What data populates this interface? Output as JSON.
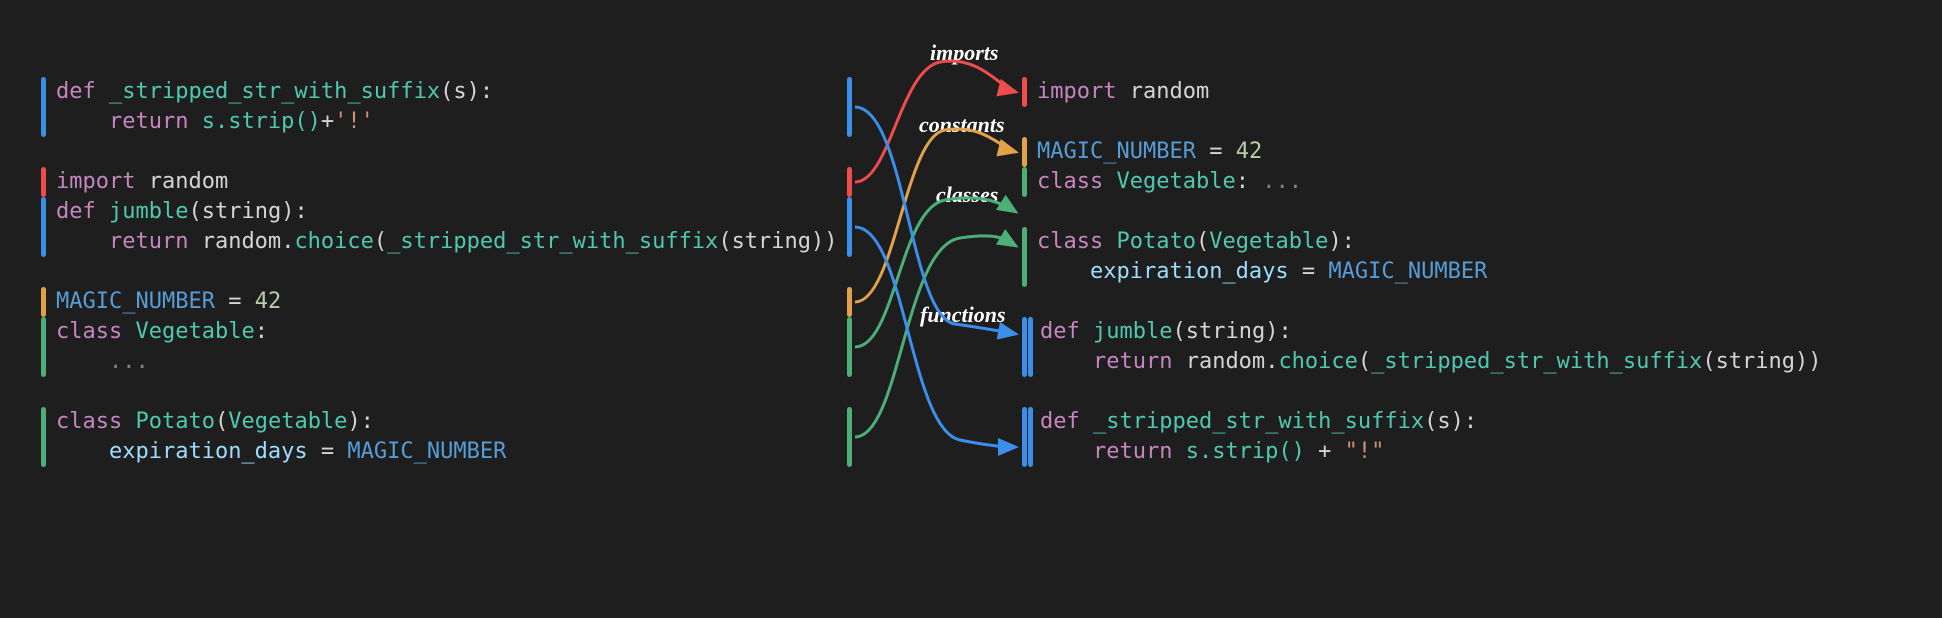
{
  "labels": {
    "imports": "imports",
    "constants": "constants",
    "classes": "classes",
    "functions": "functions"
  },
  "code": {
    "left": {
      "line1": {
        "kw": "def ",
        "fn": "_stripped_str_with_suffix",
        "pn_open": "(",
        "arg": "s",
        "pn_close": "):"
      },
      "line2": {
        "indent": "    ",
        "kw": "return ",
        "call": "s.strip()",
        "op": "+",
        "str": "'!'"
      },
      "line4": {
        "kw": "import ",
        "mod": "random"
      },
      "line5": {
        "kw": "def ",
        "fn": "jumble",
        "pn_open": "(",
        "arg": "string",
        "pn_close": "):"
      },
      "line6": {
        "indent": "    ",
        "kw": "return ",
        "ns": "random",
        "dot": ".",
        "method": "choice",
        "pn_open": "(",
        "inner": "_stripped_str_with_suffix",
        "pn_open2": "(",
        "arg": "string",
        "pn_close2": ")",
        "pn_close": ")"
      },
      "line8": {
        "name": "MAGIC_NUMBER",
        "eq": " = ",
        "val": "42"
      },
      "line9": {
        "kw": "class ",
        "cls": "Vegetable",
        "colon": ":"
      },
      "line10": {
        "indent": "    ",
        "ell": "..."
      },
      "line12": {
        "kw": "class ",
        "cls": "Potato",
        "pn_open": "(",
        "base": "Vegetable",
        "pn_close": "):"
      },
      "line13": {
        "indent": "    ",
        "prop": "expiration_days",
        "eq": " = ",
        "val": "MAGIC_NUMBER"
      }
    },
    "right": {
      "line1": {
        "kw": "import ",
        "mod": "random"
      },
      "line3": {
        "name": "MAGIC_NUMBER",
        "eq": " = ",
        "val": "42"
      },
      "line4": {
        "kw": "class ",
        "cls": "Vegetable",
        "colon": ": ",
        "ell": "..."
      },
      "line6": {
        "kw": "class ",
        "cls": "Potato",
        "pn_open": "(",
        "base": "Vegetable",
        "pn_close": "):"
      },
      "line7": {
        "indent": "    ",
        "prop": "expiration_days",
        "eq": " = ",
        "val": "MAGIC_NUMBER"
      },
      "line9": {
        "kw": "def ",
        "fn": "jumble",
        "pn_open": "(",
        "arg": "string",
        "pn_close": "):"
      },
      "line10": {
        "indent": "    ",
        "kw": "return ",
        "ns": "random",
        "dot": ".",
        "method": "choice",
        "pn_open": "(",
        "inner": "_stripped_str_with_suffix",
        "pn_open2": "(",
        "arg": "string",
        "pn_close2": ")",
        "pn_close": ")"
      },
      "line12": {
        "kw": "def ",
        "fn": "_stripped_str_with_suffix",
        "pn_open": "(",
        "arg": "s",
        "pn_close": "):"
      },
      "line13": {
        "indent": "    ",
        "kw": "return ",
        "call": "s.strip()",
        "op": " + ",
        "str": "\"!\""
      }
    }
  },
  "colors": {
    "red": "#f14c4c",
    "orange": "#e2a24a",
    "green": "#4caf77",
    "blue": "#3b8eea"
  }
}
